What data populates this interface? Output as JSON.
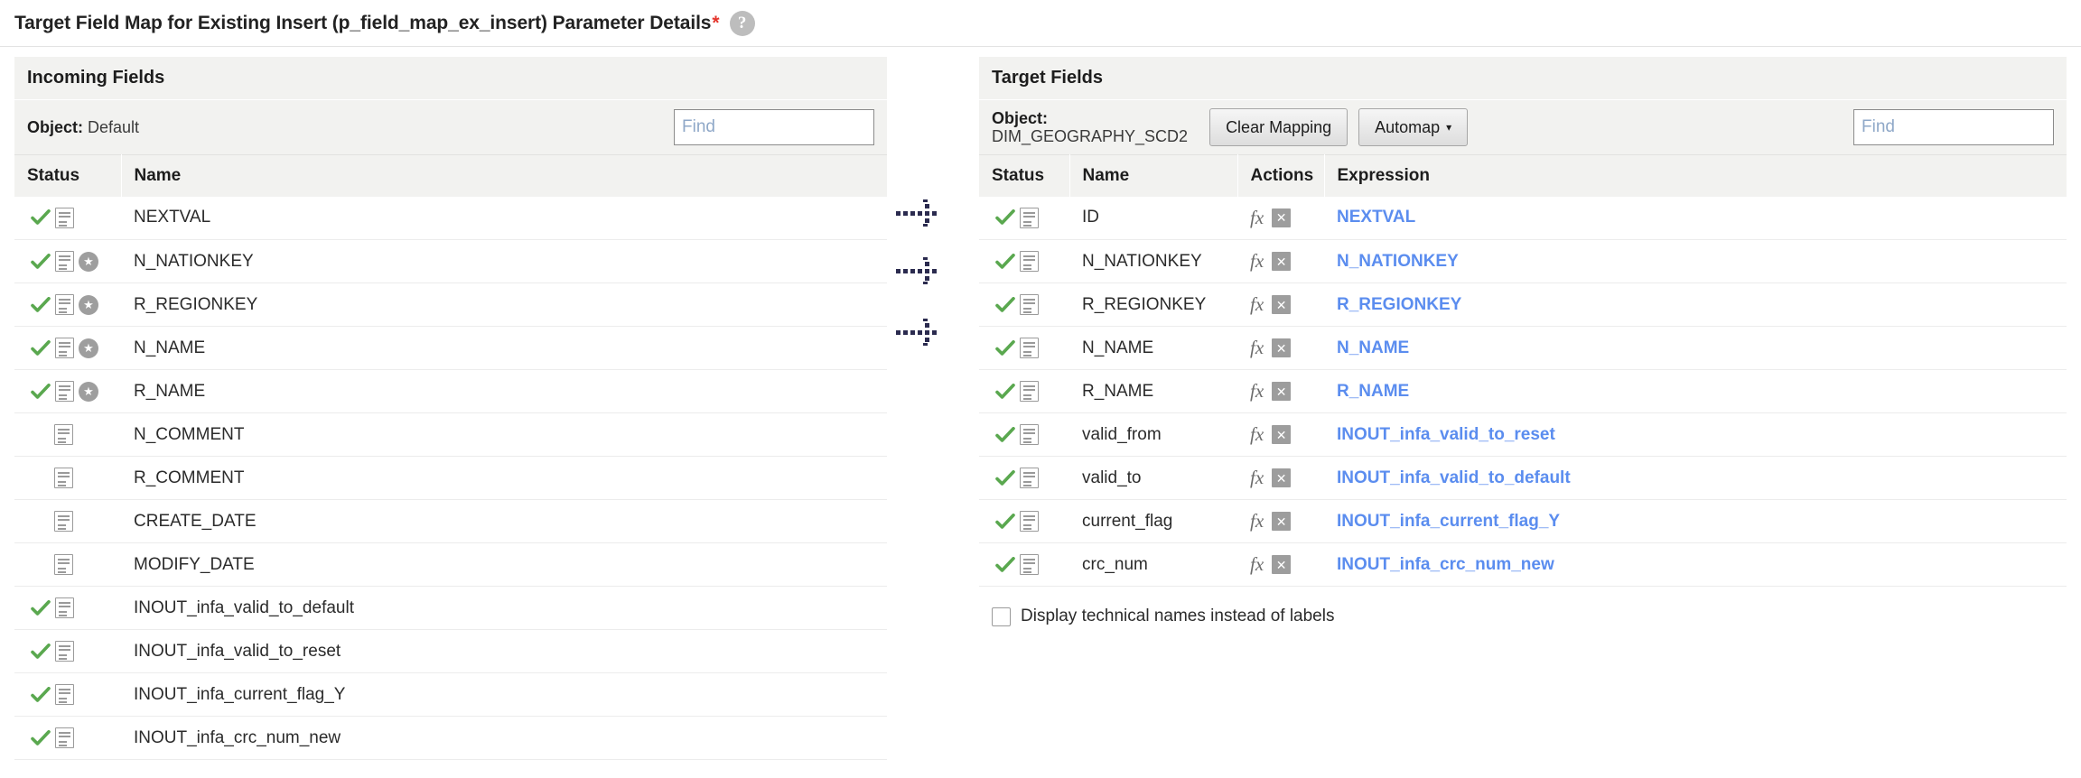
{
  "header": {
    "title": "Target Field Map for Existing Insert (p_field_map_ex_insert) Parameter Details",
    "required_marker": "*",
    "help_icon": "help-circle-icon",
    "help_glyph": "?"
  },
  "left_panel": {
    "title": "Incoming Fields",
    "object_label": "Object:",
    "object_value": "Default",
    "find_placeholder": "Find",
    "find_value": "",
    "columns": [
      "Status",
      "Name"
    ],
    "rows": [
      {
        "name": "NEXTVAL",
        "checked": true,
        "doc": true,
        "key": false
      },
      {
        "name": "N_NATIONKEY",
        "checked": true,
        "doc": true,
        "key": true
      },
      {
        "name": "R_REGIONKEY",
        "checked": true,
        "doc": true,
        "key": true
      },
      {
        "name": "N_NAME",
        "checked": true,
        "doc": true,
        "key": true
      },
      {
        "name": "R_NAME",
        "checked": true,
        "doc": true,
        "key": true
      },
      {
        "name": "N_COMMENT",
        "checked": false,
        "doc": true,
        "key": false
      },
      {
        "name": "R_COMMENT",
        "checked": false,
        "doc": true,
        "key": false
      },
      {
        "name": "CREATE_DATE",
        "checked": false,
        "doc": true,
        "key": false
      },
      {
        "name": "MODIFY_DATE",
        "checked": false,
        "doc": true,
        "key": false
      },
      {
        "name": "INOUT_infa_valid_to_default",
        "checked": true,
        "doc": true,
        "key": false
      },
      {
        "name": "INOUT_infa_valid_to_reset",
        "checked": true,
        "doc": true,
        "key": false
      },
      {
        "name": "INOUT_infa_current_flag_Y",
        "checked": true,
        "doc": true,
        "key": false
      },
      {
        "name": "INOUT_infa_crc_num_new",
        "checked": true,
        "doc": true,
        "key": false
      }
    ]
  },
  "right_panel": {
    "title": "Target Fields",
    "object_label": "Object:",
    "object_value": "DIM_GEOGRAPHY_SCD2",
    "clear_mapping_label": "Clear Mapping",
    "automap_label": "Automap",
    "automap_caret": "▾",
    "find_placeholder": "Find",
    "find_value": "",
    "columns": [
      "Status",
      "Name",
      "Actions",
      "Expression"
    ],
    "action_icons": {
      "expression": "fx",
      "clear": "✕"
    },
    "rows": [
      {
        "name": "ID",
        "expression": "NEXTVAL",
        "checked": true,
        "doc": true
      },
      {
        "name": "N_NATIONKEY",
        "expression": "N_NATIONKEY",
        "checked": true,
        "doc": true
      },
      {
        "name": "R_REGIONKEY",
        "expression": "R_REGIONKEY",
        "checked": true,
        "doc": true
      },
      {
        "name": "N_NAME",
        "expression": "N_NAME",
        "checked": true,
        "doc": true
      },
      {
        "name": "R_NAME",
        "expression": "R_NAME",
        "checked": true,
        "doc": true
      },
      {
        "name": "valid_from",
        "expression": "INOUT_infa_valid_to_reset",
        "checked": true,
        "doc": true
      },
      {
        "name": "valid_to",
        "expression": "INOUT_infa_valid_to_default",
        "checked": true,
        "doc": true
      },
      {
        "name": "current_flag",
        "expression": "INOUT_infa_current_flag_Y",
        "checked": true,
        "doc": true
      },
      {
        "name": "crc_num",
        "expression": "INOUT_infa_crc_num_new",
        "checked": true,
        "doc": true
      }
    ],
    "technical_names_checkbox": {
      "label": "Display technical names instead of labels",
      "checked": false
    }
  },
  "connectors": {
    "icon": "dotted-arrow-right-icon",
    "count": 3,
    "y_positions": [
      158,
      222,
      290
    ]
  },
  "colors": {
    "expression_link": "#5b8def",
    "status_check": "#5aa84f",
    "required_star": "#e4342b",
    "panel_header_bg": "#f2f2f0",
    "row_divider": "#ececec",
    "connector": "#2b2b4f"
  }
}
